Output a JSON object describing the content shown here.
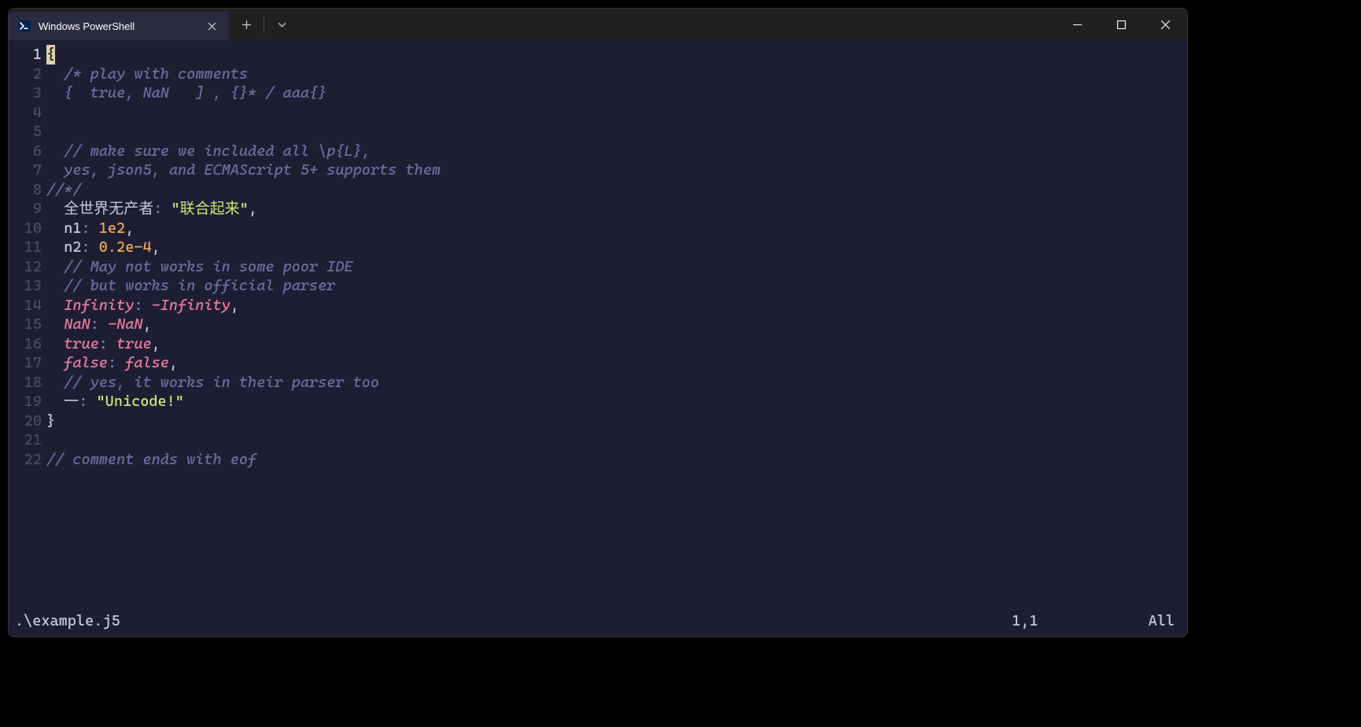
{
  "titlebar": {
    "tab_title": "Windows PowerShell"
  },
  "editor": {
    "lines": [
      {
        "n": 1,
        "current": true,
        "segs": [
          {
            "cls": "cursor",
            "t": "{"
          }
        ]
      },
      {
        "n": 2,
        "segs": [
          {
            "cls": "indent",
            "t": "  "
          },
          {
            "cls": "tok-comment",
            "t": "/* play with comments"
          }
        ]
      },
      {
        "n": 3,
        "segs": [
          {
            "cls": "indent",
            "t": "  "
          },
          {
            "cls": "tok-comment",
            "t": "{  true, NaN   ] , {}* / aaa{}"
          }
        ]
      },
      {
        "n": 4,
        "segs": []
      },
      {
        "n": 5,
        "segs": []
      },
      {
        "n": 6,
        "segs": [
          {
            "cls": "indent",
            "t": "  "
          },
          {
            "cls": "tok-comment",
            "t": "// make sure we included all \\p{L},"
          }
        ]
      },
      {
        "n": 7,
        "segs": [
          {
            "cls": "indent",
            "t": "  "
          },
          {
            "cls": "tok-comment",
            "t": "yes, json5, and ECMAScript 5+ supports them"
          }
        ]
      },
      {
        "n": 8,
        "segs": [
          {
            "cls": "tok-comment",
            "t": "//*/"
          }
        ]
      },
      {
        "n": 9,
        "segs": [
          {
            "cls": "indent",
            "t": "  "
          },
          {
            "cls": "tok-keycjk",
            "t": "全世界无产者"
          },
          {
            "cls": "tok-colon",
            "t": ": "
          },
          {
            "cls": "tok-string",
            "t": "\"联合起来\""
          },
          {
            "cls": "tok-punc",
            "t": ","
          }
        ]
      },
      {
        "n": 10,
        "segs": [
          {
            "cls": "indent",
            "t": "  "
          },
          {
            "cls": "tok-key",
            "t": "n1"
          },
          {
            "cls": "tok-colon",
            "t": ": "
          },
          {
            "cls": "tok-number",
            "t": "1e2"
          },
          {
            "cls": "tok-punc",
            "t": ","
          }
        ]
      },
      {
        "n": 11,
        "segs": [
          {
            "cls": "indent",
            "t": "  "
          },
          {
            "cls": "tok-key",
            "t": "n2"
          },
          {
            "cls": "tok-colon",
            "t": ": "
          },
          {
            "cls": "tok-number",
            "t": "0.2e-4"
          },
          {
            "cls": "tok-punc",
            "t": ","
          }
        ]
      },
      {
        "n": 12,
        "segs": [
          {
            "cls": "indent",
            "t": "  "
          },
          {
            "cls": "tok-comment",
            "t": "// May not works in some poor IDE"
          }
        ]
      },
      {
        "n": 13,
        "segs": [
          {
            "cls": "indent",
            "t": "  "
          },
          {
            "cls": "tok-comment",
            "t": "// but works in official parser"
          }
        ]
      },
      {
        "n": 14,
        "segs": [
          {
            "cls": "indent",
            "t": "  "
          },
          {
            "cls": "tok-const",
            "t": "Infinity"
          },
          {
            "cls": "tok-colon",
            "t": ": "
          },
          {
            "cls": "tok-const",
            "t": "-Infinity"
          },
          {
            "cls": "tok-punc",
            "t": ","
          }
        ]
      },
      {
        "n": 15,
        "segs": [
          {
            "cls": "indent",
            "t": "  "
          },
          {
            "cls": "tok-const",
            "t": "NaN"
          },
          {
            "cls": "tok-colon",
            "t": ": "
          },
          {
            "cls": "tok-const",
            "t": "-NaN"
          },
          {
            "cls": "tok-punc",
            "t": ","
          }
        ]
      },
      {
        "n": 16,
        "segs": [
          {
            "cls": "indent",
            "t": "  "
          },
          {
            "cls": "tok-const",
            "t": "true"
          },
          {
            "cls": "tok-colon",
            "t": ": "
          },
          {
            "cls": "tok-const",
            "t": "true"
          },
          {
            "cls": "tok-punc",
            "t": ","
          }
        ]
      },
      {
        "n": 17,
        "segs": [
          {
            "cls": "indent",
            "t": "  "
          },
          {
            "cls": "tok-const",
            "t": "false"
          },
          {
            "cls": "tok-colon",
            "t": ": "
          },
          {
            "cls": "tok-const",
            "t": "false"
          },
          {
            "cls": "tok-punc",
            "t": ","
          }
        ]
      },
      {
        "n": 18,
        "segs": [
          {
            "cls": "indent",
            "t": "  "
          },
          {
            "cls": "tok-comment",
            "t": "// yes, it works in their parser too"
          }
        ]
      },
      {
        "n": 19,
        "segs": [
          {
            "cls": "indent",
            "t": "  "
          },
          {
            "cls": "tok-key",
            "t": "一"
          },
          {
            "cls": "tok-colon",
            "t": ": "
          },
          {
            "cls": "tok-string",
            "t": "\"Unicode!\""
          }
        ]
      },
      {
        "n": 20,
        "segs": [
          {
            "cls": "tok-punc",
            "t": "}"
          }
        ]
      },
      {
        "n": 21,
        "segs": []
      },
      {
        "n": 22,
        "segs": [
          {
            "cls": "tok-comment",
            "t": "// comment ends with eof"
          }
        ]
      }
    ]
  },
  "status": {
    "filename": ".\\example.j5",
    "position": "1,1",
    "percent": "All"
  }
}
